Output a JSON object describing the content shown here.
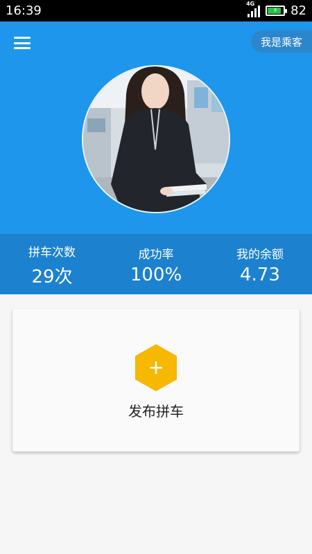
{
  "status_bar": {
    "time": "16:39",
    "network": "4G",
    "battery_level": "82"
  },
  "header": {
    "role_label": "我是乘客",
    "menu_icon": "hamburger-menu-icon",
    "background_color": "#1e96eb"
  },
  "stats": [
    {
      "label": "拼车次数",
      "value": "29次"
    },
    {
      "label": "成功率",
      "value": "100%"
    },
    {
      "label": "我的余额",
      "value": "4.73"
    }
  ],
  "publish": {
    "label": "发布拼车",
    "icon": "plus-hexagon-icon",
    "icon_color": "#f6b800"
  }
}
